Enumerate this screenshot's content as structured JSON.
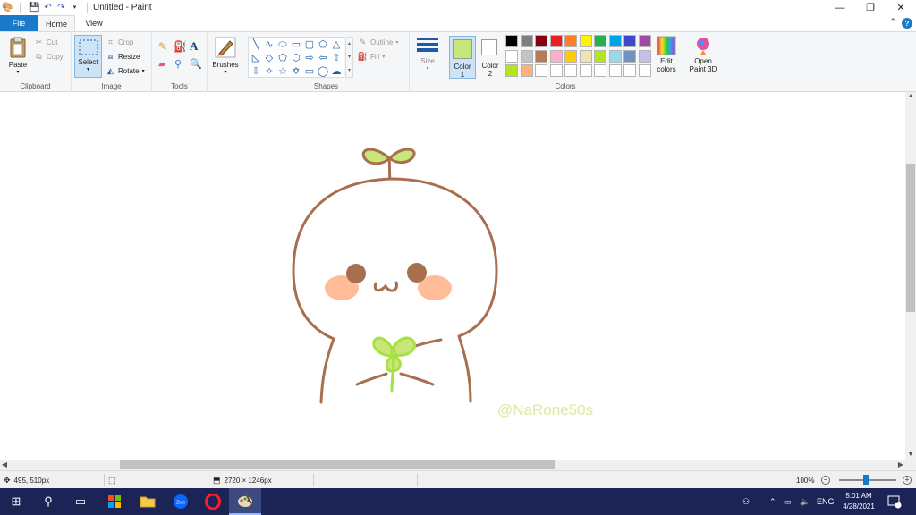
{
  "window": {
    "title": "Untitled - Paint",
    "controls": {
      "minimize": "—",
      "restore": "❐",
      "close": "✕"
    }
  },
  "tabs": {
    "file": "File",
    "home": "Home",
    "view": "View"
  },
  "clipboard": {
    "paste": "Paste",
    "cut": "Cut",
    "copy": "Copy",
    "label": "Clipboard"
  },
  "image": {
    "select": "Select",
    "crop": "Crop",
    "resize": "Resize",
    "rotate": "Rotate",
    "label": "Image"
  },
  "tools": {
    "label": "Tools"
  },
  "brushes": {
    "label": "Brushes"
  },
  "shapes": {
    "outline": "Outline",
    "fill": "Fill",
    "label": "Shapes"
  },
  "size": {
    "label": "Size"
  },
  "colors": {
    "color1": "Color",
    "color1_num": "1",
    "color2": "Color",
    "color2_num": "2",
    "color1_value": "#c8e67a",
    "color2_value": "#ffffff",
    "edit_colors": "Edit colors",
    "label": "Colors",
    "palette": [
      "#000000",
      "#7f7f7f",
      "#880015",
      "#ed1c24",
      "#ff7f27",
      "#fff200",
      "#22b14c",
      "#00a2e8",
      "#3f48cc",
      "#a349a4",
      "#ffffff",
      "#c3c3c3",
      "#b97a57",
      "#ffaec9",
      "#ffc90e",
      "#efe4b0",
      "#b5e61d",
      "#99d9ea",
      "#7092be",
      "#c8bfe7",
      "#b5e61d",
      "#ffb07c",
      "#ffffff",
      "#ffffff",
      "#ffffff",
      "#ffffff",
      "#ffffff",
      "#ffffff",
      "#ffffff",
      "#ffffff"
    ]
  },
  "paint3d": {
    "label": "Open Paint 3D"
  },
  "canvas": {
    "watermark": "@NaRone50s",
    "stroke_color": "#a86f4f",
    "leaf_color": "#c8e67a",
    "clover_color": "#a8e042",
    "blush_color": "#ffbc96",
    "eye_color": "#a86f4f"
  },
  "status": {
    "cursor_pos": "495, 510px",
    "canvas_size": "2720 × 1246px",
    "zoom": "100%"
  },
  "taskbar": {
    "language": "ENG",
    "time": "5:01 AM",
    "date": "4/28/2021",
    "notification_count": "1"
  }
}
